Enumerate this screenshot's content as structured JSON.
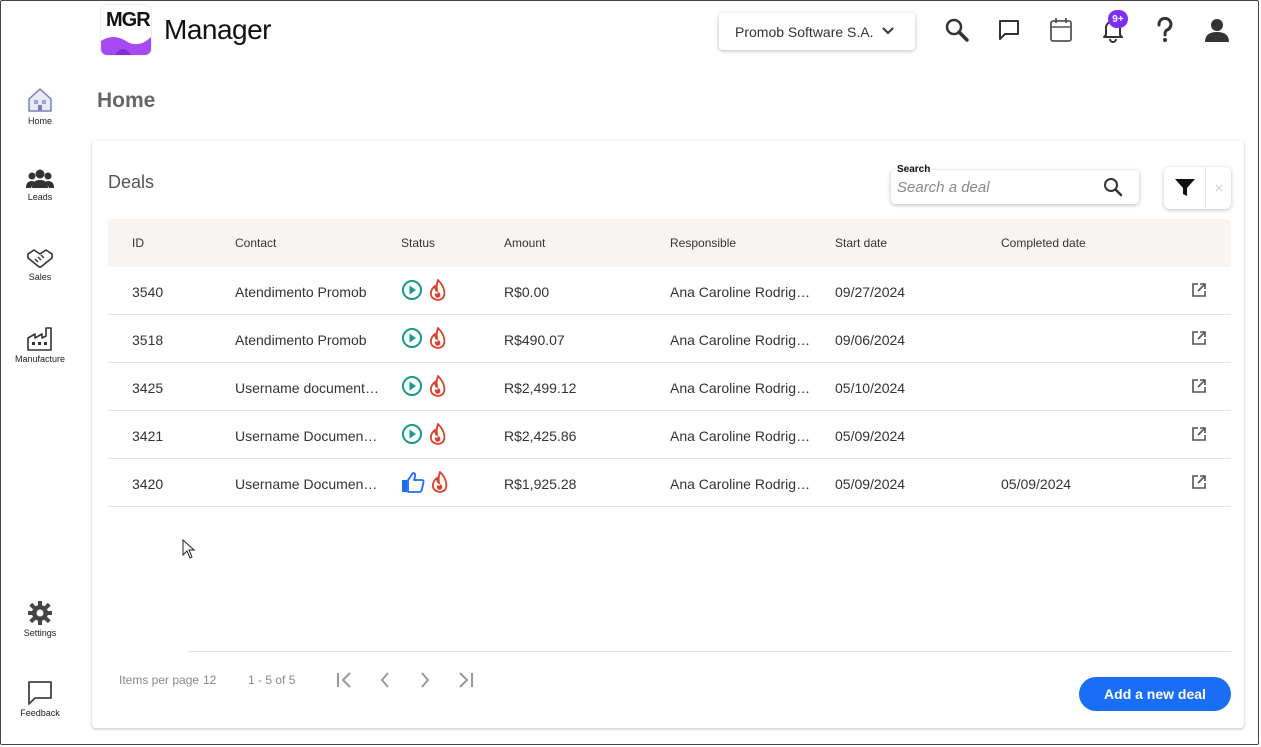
{
  "app": {
    "logo_text": "MGR",
    "title": "Manager",
    "company": "Promob Software S.A.",
    "notification_badge": "9+"
  },
  "sidebar": {
    "items": [
      {
        "label": "Home",
        "icon": "home-icon"
      },
      {
        "label": "Leads",
        "icon": "people-icon"
      },
      {
        "label": "Sales",
        "icon": "handshake-icon"
      },
      {
        "label": "Manufacture",
        "icon": "factory-icon"
      },
      {
        "label": "Settings",
        "icon": "gear-icon"
      },
      {
        "label": "Feedback",
        "icon": "chat-bubble-icon"
      }
    ]
  },
  "page": {
    "title": "Home"
  },
  "deals": {
    "title": "Deals",
    "search_label": "Search",
    "search_placeholder": "Search a deal",
    "columns": [
      "ID",
      "Contact",
      "Status",
      "Amount",
      "Responsible",
      "Start date",
      "Completed date"
    ],
    "rows": [
      {
        "id": "3540",
        "contact": "Atendimento Promob",
        "status": "in-progress",
        "amount": "R$0.00",
        "responsible": "Ana Caroline Rodrigues",
        "start": "09/27/2024",
        "completed": ""
      },
      {
        "id": "3518",
        "contact": "Atendimento Promob",
        "status": "in-progress",
        "amount": "R$490.07",
        "responsible": "Ana Caroline Rodrigues",
        "start": "09/06/2024",
        "completed": ""
      },
      {
        "id": "3425",
        "contact": "Username documentation",
        "status": "in-progress",
        "amount": "R$2,499.12",
        "responsible": "Ana Caroline Rodrigues",
        "start": "05/10/2024",
        "completed": ""
      },
      {
        "id": "3421",
        "contact": "Username Documentation",
        "status": "in-progress",
        "amount": "R$2,425.86",
        "responsible": "Ana Caroline Rodrigues",
        "start": "05/09/2024",
        "completed": ""
      },
      {
        "id": "3420",
        "contact": "Username Documentation",
        "status": "won",
        "amount": "R$1,925.28",
        "responsible": "Ana Caroline Rodrigues",
        "start": "05/09/2024",
        "completed": "05/09/2024"
      }
    ],
    "items_per_page_label": "Items per page",
    "items_per_page": "12",
    "range": "1 - 5 of 5",
    "add_label": "Add a new deal"
  },
  "colors": {
    "accent": "#1a6ef5",
    "badge": "#7b2ff7",
    "status_play": "#1a9a8a",
    "status_hot": "#d9412b",
    "status_won": "#1a6ef5"
  }
}
